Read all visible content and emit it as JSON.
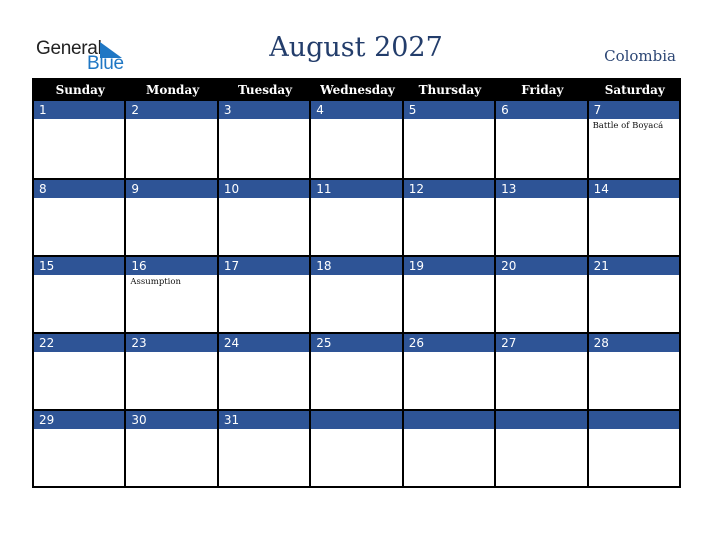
{
  "logo": {
    "word1": "General",
    "word2": "Blue"
  },
  "title": "August 2027",
  "country": "Colombia",
  "colors": {
    "band": "#2e5496",
    "header": "#000000",
    "title": "#233d6b"
  },
  "weekdays": [
    "Sunday",
    "Monday",
    "Tuesday",
    "Wednesday",
    "Thursday",
    "Friday",
    "Saturday"
  ],
  "weeks": [
    [
      {
        "d": "1",
        "e": ""
      },
      {
        "d": "2",
        "e": ""
      },
      {
        "d": "3",
        "e": ""
      },
      {
        "d": "4",
        "e": ""
      },
      {
        "d": "5",
        "e": ""
      },
      {
        "d": "6",
        "e": ""
      },
      {
        "d": "7",
        "e": "Battle of Boyacá"
      }
    ],
    [
      {
        "d": "8",
        "e": ""
      },
      {
        "d": "9",
        "e": ""
      },
      {
        "d": "10",
        "e": ""
      },
      {
        "d": "11",
        "e": ""
      },
      {
        "d": "12",
        "e": ""
      },
      {
        "d": "13",
        "e": ""
      },
      {
        "d": "14",
        "e": ""
      }
    ],
    [
      {
        "d": "15",
        "e": ""
      },
      {
        "d": "16",
        "e": "Assumption"
      },
      {
        "d": "17",
        "e": ""
      },
      {
        "d": "18",
        "e": ""
      },
      {
        "d": "19",
        "e": ""
      },
      {
        "d": "20",
        "e": ""
      },
      {
        "d": "21",
        "e": ""
      }
    ],
    [
      {
        "d": "22",
        "e": ""
      },
      {
        "d": "23",
        "e": ""
      },
      {
        "d": "24",
        "e": ""
      },
      {
        "d": "25",
        "e": ""
      },
      {
        "d": "26",
        "e": ""
      },
      {
        "d": "27",
        "e": ""
      },
      {
        "d": "28",
        "e": ""
      }
    ],
    [
      {
        "d": "29",
        "e": ""
      },
      {
        "d": "30",
        "e": ""
      },
      {
        "d": "31",
        "e": ""
      },
      {
        "d": "",
        "e": ""
      },
      {
        "d": "",
        "e": ""
      },
      {
        "d": "",
        "e": ""
      },
      {
        "d": "",
        "e": ""
      }
    ]
  ]
}
